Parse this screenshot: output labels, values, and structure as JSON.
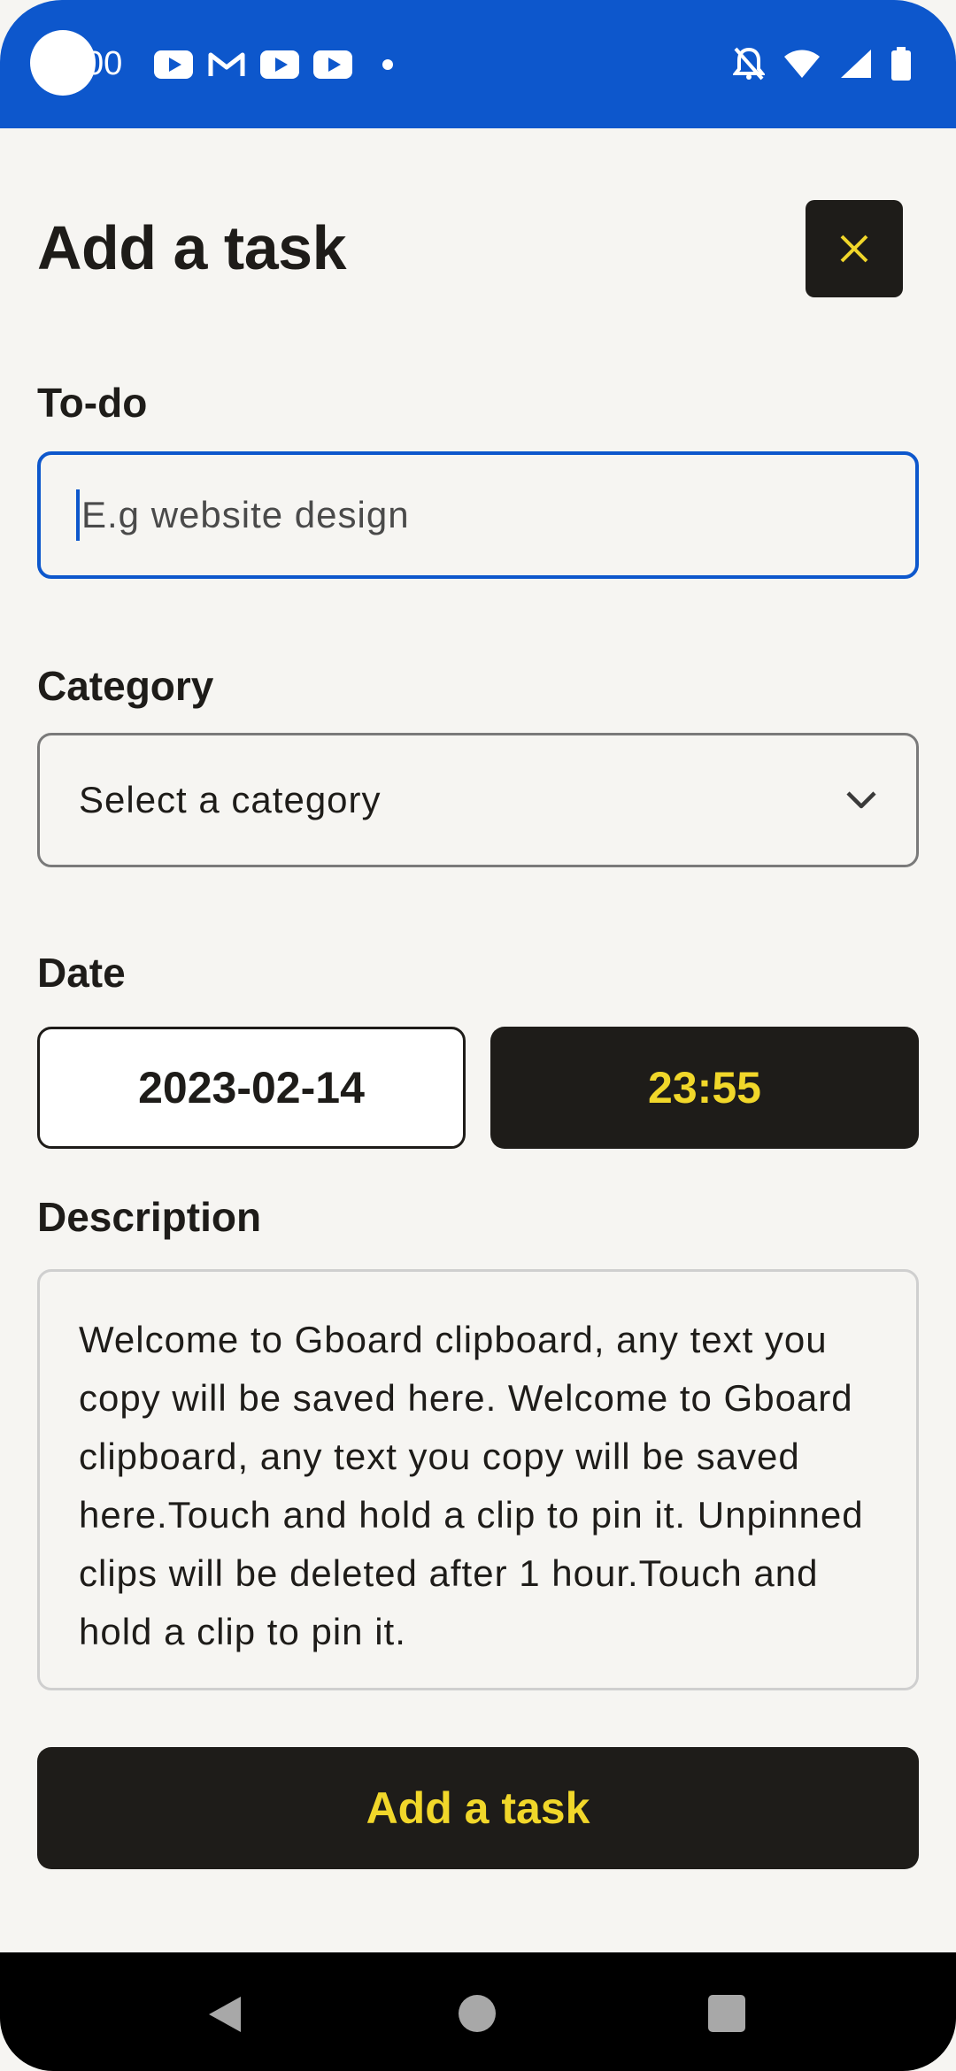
{
  "status_bar": {
    "time": "00",
    "color": "#0d57cc",
    "left_icons": [
      "youtube-icon",
      "gmail-icon",
      "youtube-icon",
      "youtube-icon",
      "notification-dot-icon"
    ],
    "right_icons": [
      "notifications-off-icon",
      "wifi-icon",
      "cell-signal-icon",
      "battery-icon"
    ]
  },
  "header": {
    "title": "Add a task",
    "close_icon": "close-icon"
  },
  "form": {
    "todo": {
      "label": "To-do",
      "placeholder": "E.g website design",
      "value": ""
    },
    "category": {
      "label": "Category",
      "selected": "Select a category"
    },
    "date": {
      "label": "Date",
      "date_value": "2023-02-14",
      "time_value": "23:55"
    },
    "description": {
      "label": "Description",
      "value": "Welcome to Gboard clipboard, any text you copy will be saved here. Welcome to Gboard clipboard, any text you copy will be saved here.Touch and hold a clip to pin it. Unpinned clips will be deleted after 1 hour.Touch and hold a clip to pin it."
    },
    "submit_label": "Add a task"
  },
  "colors": {
    "accent_yellow": "#f1d72a",
    "dark": "#1e1c19",
    "focus_blue": "#0d57cc",
    "background": "#f6f5f2"
  },
  "nav_bar": {
    "icons": [
      "back-icon",
      "home-icon",
      "recents-icon"
    ]
  }
}
